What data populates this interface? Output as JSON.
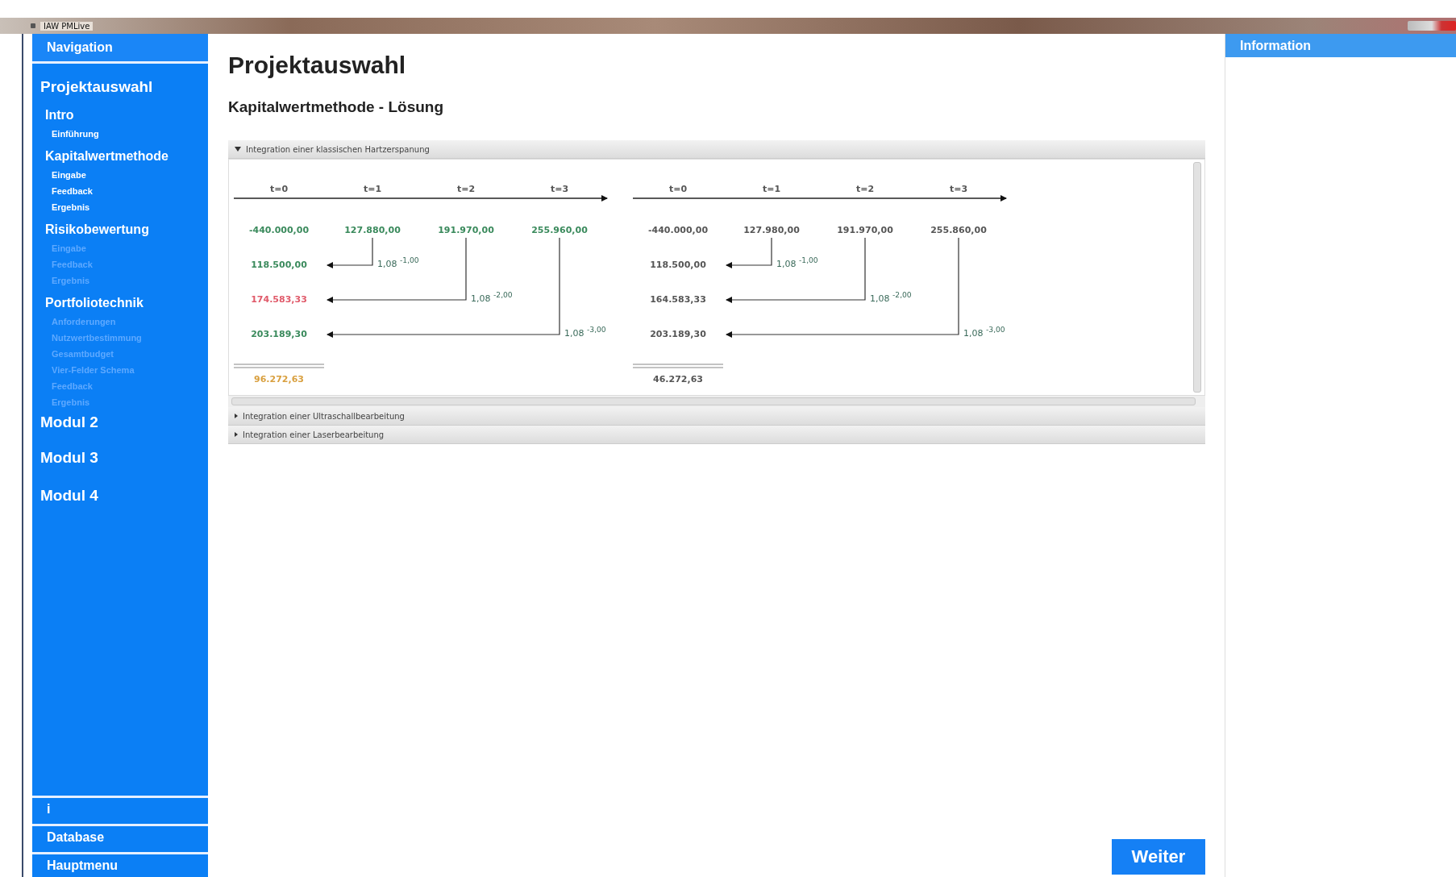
{
  "window": {
    "title": "IAW PMLive"
  },
  "navigation": {
    "header": "Navigation",
    "items": [
      {
        "label": "Projektauswahl",
        "disabled": false,
        "children": [
          {
            "label": "Intro",
            "disabled": false,
            "children": [
              {
                "label": "Einführung",
                "disabled": false
              }
            ]
          },
          {
            "label": "Kapitalwertmethode",
            "disabled": false,
            "children": [
              {
                "label": "Eingabe",
                "disabled": false
              },
              {
                "label": "Feedback",
                "disabled": false
              },
              {
                "label": "Ergebnis",
                "disabled": false
              }
            ]
          },
          {
            "label": "Risikobewertung",
            "disabled": false,
            "children": [
              {
                "label": "Eingabe",
                "disabled": true
              },
              {
                "label": "Feedback",
                "disabled": true
              },
              {
                "label": "Ergebnis",
                "disabled": true
              }
            ]
          },
          {
            "label": "Portfoliotechnik",
            "disabled": false,
            "children": [
              {
                "label": "Anforderungen",
                "disabled": true
              },
              {
                "label": "Nutzwertbestimmung",
                "disabled": true
              },
              {
                "label": "Gesamtbudget",
                "disabled": true
              },
              {
                "label": "Vier-Felder Schema",
                "disabled": true
              },
              {
                "label": "Feedback",
                "disabled": true
              },
              {
                "label": "Ergebnis",
                "disabled": true
              }
            ]
          }
        ]
      },
      {
        "label": "Modul 2",
        "disabled": false
      },
      {
        "label": "Modul 3",
        "disabled": false
      },
      {
        "label": "Modul 4",
        "disabled": false
      }
    ],
    "bottom_buttons": [
      "i",
      "Database",
      "Hauptmenu"
    ]
  },
  "main": {
    "title": "Projektauswahl",
    "subtitle": "Kapitalwertmethode - Lösung",
    "sections": [
      {
        "title": "Integration einer klassischen Hartzerspanung",
        "expanded": true,
        "diagrams": [
          {
            "periods": [
              "t=0",
              "t=1",
              "t=2",
              "t=3"
            ],
            "cashflows": [
              {
                "text": "-440.000,00",
                "color": "#3a8a5c"
              },
              {
                "text": "127.880,00",
                "color": "#3a8a5c"
              },
              {
                "text": "191.970,00",
                "color": "#3a8a5c"
              },
              {
                "text": "255.960,00",
                "color": "#3a8a5c"
              }
            ],
            "present_values": [
              {
                "text": "118.500,00",
                "color": "#3a8a5c"
              },
              {
                "text": "174.583,33",
                "color": "#e05a6a"
              },
              {
                "text": "203.189,30",
                "color": "#3a8a5c"
              }
            ],
            "factors": [
              "1,08 $^{-1,00}$",
              "1,08 $^{-2,00}$",
              "1,08 $^{-3,00}$"
            ],
            "result": {
              "text": "96.272,63",
              "color": "#d9a040"
            }
          },
          {
            "periods": [
              "t=0",
              "t=1",
              "t=2",
              "t=3"
            ],
            "cashflows": [
              {
                "text": "-440.000,00",
                "color": "#555555"
              },
              {
                "text": "127.980,00",
                "color": "#555555"
              },
              {
                "text": "191.970,00",
                "color": "#555555"
              },
              {
                "text": "255.860,00",
                "color": "#555555"
              }
            ],
            "present_values": [
              {
                "text": "118.500,00",
                "color": "#555555"
              },
              {
                "text": "164.583,33",
                "color": "#555555"
              },
              {
                "text": "203.189,30",
                "color": "#555555"
              }
            ],
            "factors": [
              "1,08 $^{-1,00}$",
              "1,08 $^{-2,00}$",
              "1,08 $^{-3,00}$"
            ],
            "result": {
              "text": "46.272,63",
              "color": "#555555"
            }
          }
        ]
      },
      {
        "title": "Integration einer Ultraschallbearbeitung",
        "expanded": false
      },
      {
        "title": "Integration einer Laserbearbeitung",
        "expanded": false
      }
    ],
    "next_button": "Weiter"
  },
  "info_panel": {
    "header": "Information"
  }
}
